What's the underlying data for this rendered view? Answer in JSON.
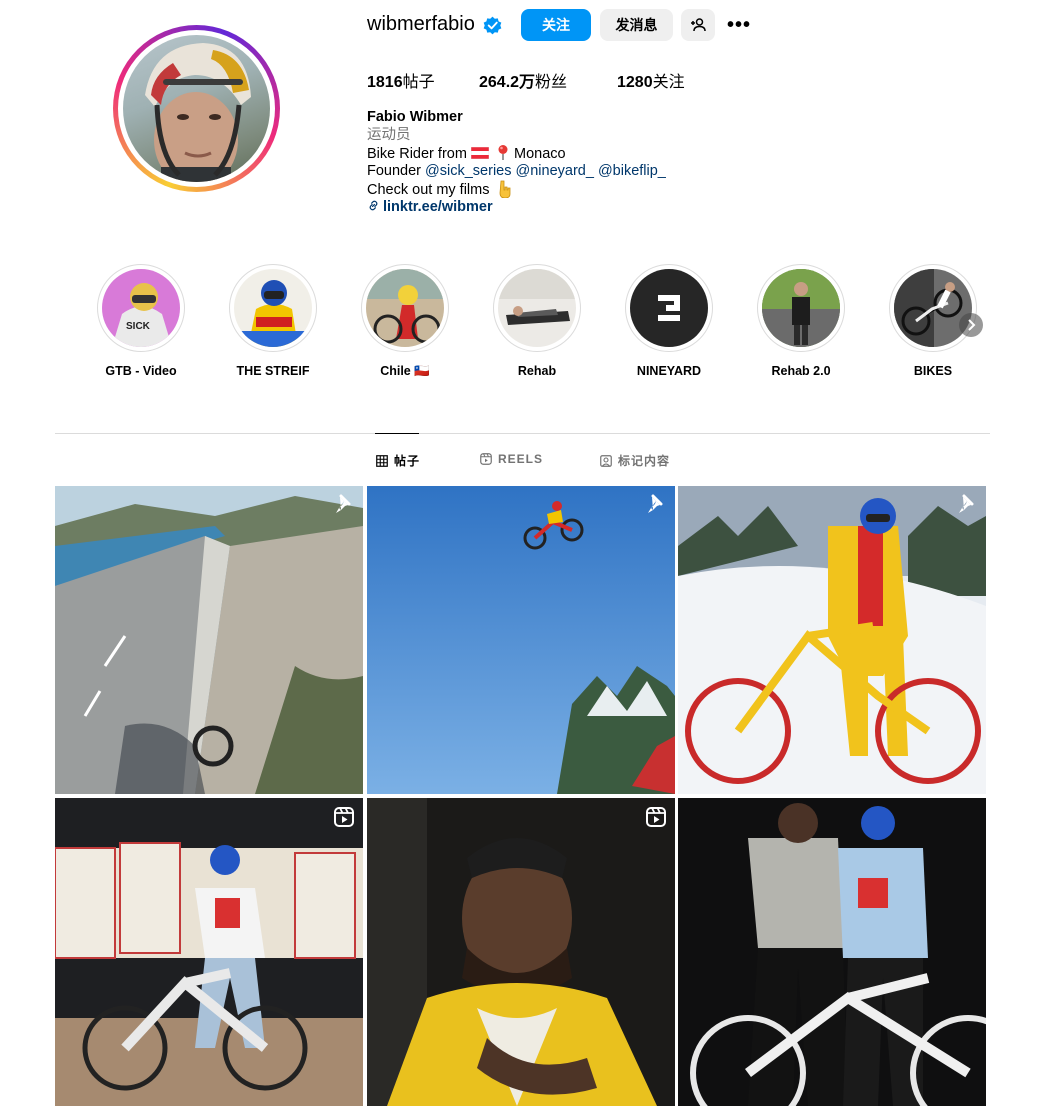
{
  "profile": {
    "username": "wibmerfabio",
    "follow_label": "关注",
    "message_label": "发消息",
    "more_label": "•••",
    "stats": {
      "posts": "1816",
      "posts_label": "帖子",
      "followers": "264.2万",
      "followers_label": "粉丝",
      "following": "1280",
      "following_label": "关注"
    },
    "display_name": "Fabio Wibmer",
    "category": "运动员",
    "bio": {
      "line1_prefix": "Bike Rider from ",
      "line1_suffix": " Monaco",
      "line2_prefix": "Founder ",
      "mentions": [
        "@sick_series",
        "@nineyard_",
        "@bikeflip_"
      ],
      "line3": "Check out my films",
      "link": "linktr.ee/wibmer"
    }
  },
  "highlights": [
    {
      "label": "GTB - Video"
    },
    {
      "label": "THE STREIF"
    },
    {
      "label": "Chile 🇨🇱"
    },
    {
      "label": "Rehab"
    },
    {
      "label": "NINEYARD"
    },
    {
      "label": "Rehab 2.0"
    },
    {
      "label": "BIKES"
    }
  ],
  "tabs": [
    {
      "label": "帖子",
      "active": true
    },
    {
      "label": "REELS",
      "active": false
    },
    {
      "label": "标记内容",
      "active": false
    }
  ],
  "posts": [
    {
      "badge": "pinned-icon"
    },
    {
      "badge": "pinned-icon"
    },
    {
      "badge": "pinned-icon"
    },
    {
      "badge": "reel-icon"
    },
    {
      "badge": "reel-icon"
    },
    {
      "badge": "none"
    }
  ],
  "colors": {
    "accent": "#0095f6",
    "link": "#00376b",
    "secondary_text": "#737373",
    "button_gray": "#efefef"
  }
}
